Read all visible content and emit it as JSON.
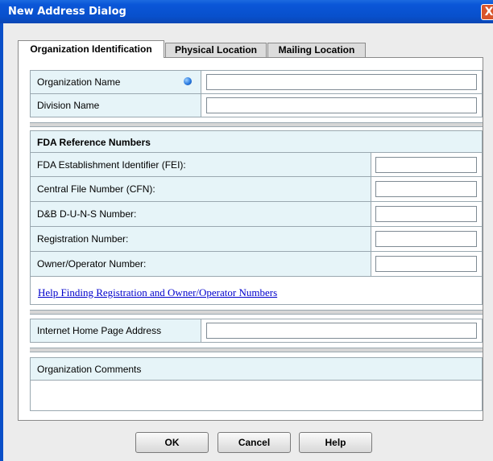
{
  "window": {
    "title": "New Address Dialog",
    "close_label": "X"
  },
  "tabs": [
    {
      "label": "Organization Identification"
    },
    {
      "label": "Physical Location"
    },
    {
      "label": "Mailing Location"
    }
  ],
  "org": {
    "name_label": "Organization Name",
    "name_value": "",
    "division_label": "Division Name",
    "division_value": ""
  },
  "fda": {
    "header": "FDA Reference Numbers",
    "rows": [
      {
        "label": "FDA Establishment Identifier (FEI):",
        "value": ""
      },
      {
        "label": "Central File Number (CFN):",
        "value": ""
      },
      {
        "label": "D&B D-U-N-S Number:",
        "value": ""
      },
      {
        "label": "Registration Number:",
        "value": ""
      },
      {
        "label": "Owner/Operator Number:",
        "value": ""
      }
    ],
    "help_link": "Help Finding Registration and Owner/Operator Numbers"
  },
  "web": {
    "label": "Internet Home Page Address",
    "value": ""
  },
  "comments": {
    "label": "Organization Comments",
    "value": ""
  },
  "buttons": {
    "ok": "OK",
    "cancel": "Cancel",
    "help": "Help"
  }
}
